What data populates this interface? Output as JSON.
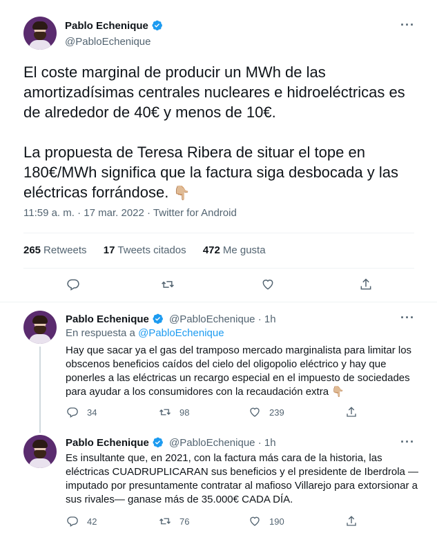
{
  "main_tweet": {
    "author_name": "Pablo Echenique",
    "author_handle": "@PabloEchenique",
    "paragraph1": "El coste marginal de producir un MWh de las amortizadísimas centrales nucleares e hidroeléctricas es de alrededor de 40€ y menos de 10€.",
    "paragraph2": "La propuesta de Teresa Ribera de situar el tope en 180€/MWh significa que la factura siga desbocada y las eléctricas forrándose.",
    "emoji": "👇🏼",
    "time": "11:59 a. m.",
    "date": "17 mar. 2022",
    "source": "Twitter for Android",
    "retweets_count": "265",
    "retweets_label": "Retweets",
    "quotes_count": "17",
    "quotes_label": "Tweets citados",
    "likes_count": "472",
    "likes_label": "Me gusta",
    "more_label": "···"
  },
  "replies": [
    {
      "author_name": "Pablo Echenique",
      "author_handle": "@PabloEchenique",
      "age": "· 1h",
      "reply_prefix": "En respuesta a",
      "reply_to": "@PabloEchenique",
      "text": "Hay que sacar ya el gas del tramposo mercado marginalista para limitar los obscenos beneficios caídos del cielo del oligopolio eléctrico y hay que ponerles a las eléctricas un recargo especial en el impuesto de sociedades para ayudar a los consumidores con la recaudación extra",
      "emoji": "👇🏼",
      "replies": "34",
      "retweets": "98",
      "likes": "239",
      "more_label": "···"
    },
    {
      "author_name": "Pablo Echenique",
      "author_handle": "@PabloEchenique",
      "age": "· 1h",
      "text": "Es insultante que, en 2021, con la factura más cara de la historia, las eléctricas CUADRUPLICARAN sus beneficios y el presidente de Iberdrola —imputado por presuntamente contratar al mafioso Villarejo para extorsionar a sus rivales— ganase más de 35.000€ CADA DÍA.",
      "replies": "42",
      "retweets": "76",
      "likes": "190",
      "more_label": "···"
    }
  ],
  "colors": {
    "accent": "#1d9bf0",
    "text": "#0f1419",
    "secondary": "#536471",
    "divider": "#eff3f4"
  },
  "icons": [
    "verified-badge-icon",
    "more-icon",
    "reply-icon",
    "retweet-icon",
    "like-icon",
    "share-icon"
  ]
}
